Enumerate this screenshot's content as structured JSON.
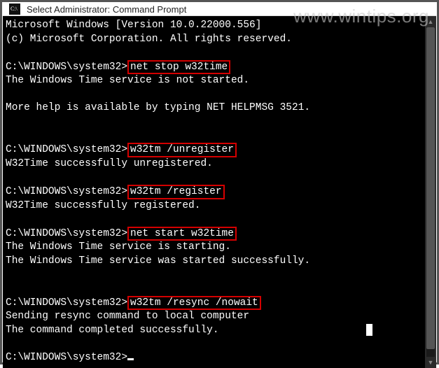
{
  "watermark": "www.wintips.org",
  "titlebar": {
    "icon_name": "cmd-icon",
    "title": "Select Administrator: Command Prompt"
  },
  "terminal": {
    "header1": "Microsoft Windows [Version 10.0.22000.556]",
    "header2": "(c) Microsoft Corporation. All rights reserved.",
    "prompt": "C:\\WINDOWS\\system32>",
    "cmd1": "net stop w32time",
    "out1": "The Windows Time service is not started.",
    "out1b": "More help is available by typing NET HELPMSG 3521.",
    "cmd2": "w32tm /unregister",
    "out2": "W32Time successfully unregistered.",
    "cmd3": "w32tm /register",
    "out3": "W32Time successfully registered.",
    "cmd4": "net start w32time",
    "out4a": "The Windows Time service is starting.",
    "out4b": "The Windows Time service was started successfully.",
    "cmd5": "w32tm /resync /nowait",
    "out5a": "Sending resync command to local computer",
    "out5b": "The command completed successfully."
  }
}
